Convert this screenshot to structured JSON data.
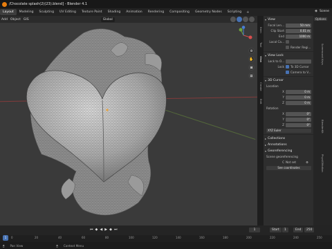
{
  "window": {
    "title": "/Chocolate splash(2)(23).blend] - Blender 4.1"
  },
  "workspaces": {
    "tabs": [
      "Layout",
      "Modeling",
      "Sculpting",
      "UV Editing",
      "Texture Paint",
      "Shading",
      "Animation",
      "Rendering",
      "Compositing",
      "Geometry Nodes",
      "Scripting"
    ],
    "add": "+",
    "scene_label": "Scene"
  },
  "header": {
    "menus": [
      "Add",
      "Object",
      "GIS"
    ],
    "transform_orientation": "Global"
  },
  "sidebar_tabs": [
    "Item",
    "Tool",
    "View",
    "Create",
    "Edit",
    "Screencast Keys",
    "BlenderKit",
    "PhysiOMotion"
  ],
  "n_panel": {
    "view_header": "View",
    "focal_length_label": "Focal Len...",
    "focal_length_value": "50 mm",
    "clip_start_label": "Clip Start",
    "clip_start_value": "0.01 m",
    "clip_end_label": "End",
    "clip_end_value": "1000 m",
    "local_camera_label": "Local Ca...",
    "render_region_label": "Render Regi...",
    "view_lock_header": "View Lock",
    "lock_to_object_label": "Lock to O...",
    "lock_label": "Lock",
    "to_3d_cursor": "To 3D Cursor",
    "camera_to_view": "Camera to V...",
    "cursor_header": "3D Cursor",
    "location_label": "Location",
    "x_label": "X",
    "x_value": "0 m",
    "y_label": "Y",
    "y_value": "0 m",
    "z_label": "Z",
    "z_value": "0 m",
    "rotation_label": "Rotation",
    "rx_value": "0°",
    "ry_value": "0°",
    "rz_value": "0°",
    "rotation_mode": "XYZ Euler",
    "collections_header": "Collections",
    "annotations_header": "Annotations",
    "georeferencing_header": "Georeferencing",
    "scene_geo_label": "Scene georeferencing",
    "crs_label": "C",
    "crs_value": "Not set",
    "see_coords": "See coordinates"
  },
  "options_label": "Options",
  "timeline": {
    "start_label": "Start",
    "start_value": "1",
    "end_label": "End",
    "end_value": "250",
    "current_frame": "1",
    "ticks": [
      "0",
      "20",
      "40",
      "60",
      "80",
      "100",
      "120",
      "140",
      "160",
      "180",
      "200",
      "220",
      "240",
      "250"
    ]
  },
  "status": {
    "left": "Pan View",
    "right": "Context Menu"
  }
}
